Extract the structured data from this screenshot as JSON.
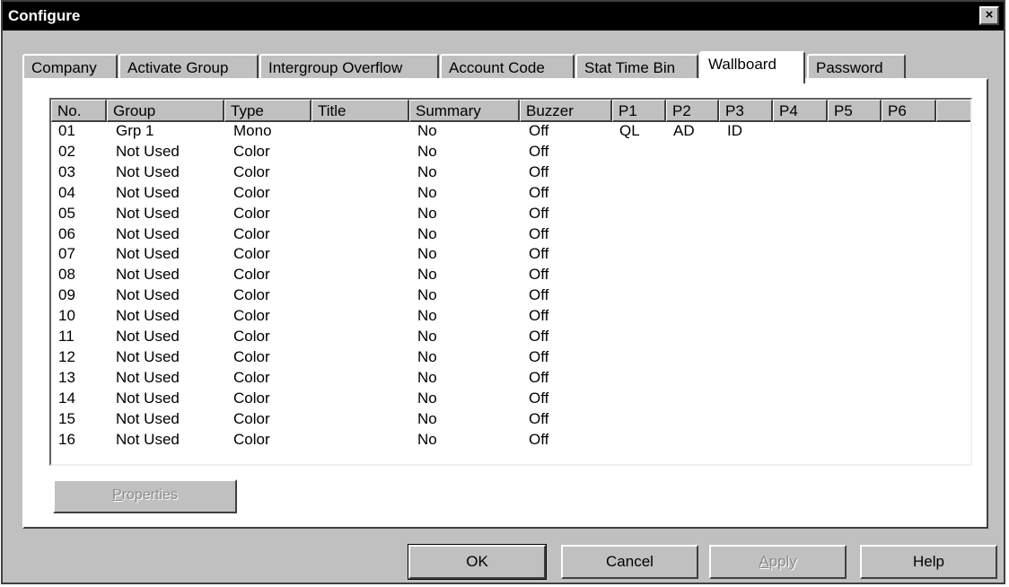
{
  "window": {
    "title": "Configure",
    "close_label": "×"
  },
  "tabs": [
    {
      "label": "Company"
    },
    {
      "label": "Activate Group"
    },
    {
      "label": "Intergroup Overflow"
    },
    {
      "label": "Account Code"
    },
    {
      "label": "Stat Time Bin"
    },
    {
      "label": "Wallboard",
      "active": true
    },
    {
      "label": "Password"
    }
  ],
  "table": {
    "columns": [
      "No.",
      "Group",
      "Type",
      "Title",
      "Summary",
      "Buzzer",
      "P1",
      "P2",
      "P3",
      "P4",
      "P5",
      "P6"
    ],
    "rows": [
      [
        "01",
        "Grp 1",
        "Mono",
        "",
        "No",
        "Off",
        "QL",
        "AD",
        "ID",
        "",
        "",
        ""
      ],
      [
        "02",
        "Not Used",
        "Color",
        "",
        "No",
        "Off",
        "",
        "",
        "",
        "",
        "",
        ""
      ],
      [
        "03",
        "Not Used",
        "Color",
        "",
        "No",
        "Off",
        "",
        "",
        "",
        "",
        "",
        ""
      ],
      [
        "04",
        "Not Used",
        "Color",
        "",
        "No",
        "Off",
        "",
        "",
        "",
        "",
        "",
        ""
      ],
      [
        "05",
        "Not Used",
        "Color",
        "",
        "No",
        "Off",
        "",
        "",
        "",
        "",
        "",
        ""
      ],
      [
        "06",
        "Not Used",
        "Color",
        "",
        "No",
        "Off",
        "",
        "",
        "",
        "",
        "",
        ""
      ],
      [
        "07",
        "Not Used",
        "Color",
        "",
        "No",
        "Off",
        "",
        "",
        "",
        "",
        "",
        ""
      ],
      [
        "08",
        "Not Used",
        "Color",
        "",
        "No",
        "Off",
        "",
        "",
        "",
        "",
        "",
        ""
      ],
      [
        "09",
        "Not Used",
        "Color",
        "",
        "No",
        "Off",
        "",
        "",
        "",
        "",
        "",
        ""
      ],
      [
        "10",
        "Not Used",
        "Color",
        "",
        "No",
        "Off",
        "",
        "",
        "",
        "",
        "",
        ""
      ],
      [
        "11",
        "Not Used",
        "Color",
        "",
        "No",
        "Off",
        "",
        "",
        "",
        "",
        "",
        ""
      ],
      [
        "12",
        "Not Used",
        "Color",
        "",
        "No",
        "Off",
        "",
        "",
        "",
        "",
        "",
        ""
      ],
      [
        "13",
        "Not Used",
        "Color",
        "",
        "No",
        "Off",
        "",
        "",
        "",
        "",
        "",
        ""
      ],
      [
        "14",
        "Not Used",
        "Color",
        "",
        "No",
        "Off",
        "",
        "",
        "",
        "",
        "",
        ""
      ],
      [
        "15",
        "Not Used",
        "Color",
        "",
        "No",
        "Off",
        "",
        "",
        "",
        "",
        "",
        ""
      ],
      [
        "16",
        "Not Used",
        "Color",
        "",
        "No",
        "Off",
        "",
        "",
        "",
        "",
        "",
        ""
      ]
    ]
  },
  "properties_button": {
    "label_first": "P",
    "label_rest": "roperties",
    "enabled": false
  },
  "buttons": {
    "ok": "OK",
    "cancel": "Cancel",
    "apply_first": "A",
    "apply_rest": "pply",
    "help": "Help"
  }
}
